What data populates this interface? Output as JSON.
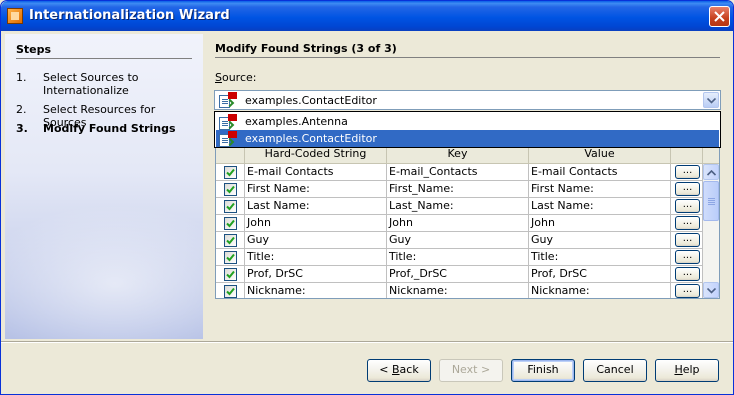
{
  "window": {
    "title": "Internationalization Wizard"
  },
  "steps": {
    "heading": "Steps",
    "items": [
      {
        "num": "1.",
        "label": "Select Sources to Internationalize"
      },
      {
        "num": "2.",
        "label": "Select Resources for Sources"
      },
      {
        "num": "3.",
        "label": "Modify Found Strings"
      }
    ]
  },
  "main": {
    "title": "Modify Found Strings (3 of 3)",
    "source_label": "Source:",
    "source_value": "examples.ContactEditor",
    "dropdown_options": [
      "examples.Antenna",
      "examples.ContactEditor"
    ]
  },
  "table": {
    "columns": [
      "",
      "Hard-Coded String",
      "Key",
      "Value",
      ""
    ],
    "button_label": "...",
    "rows": [
      {
        "checked": true,
        "string": "E-mail Contacts",
        "key": "E-mail_Contacts",
        "value": "E-mail Contacts"
      },
      {
        "checked": true,
        "string": "First Name:",
        "key": "First_Name:",
        "value": "First Name:"
      },
      {
        "checked": true,
        "string": "Last Name:",
        "key": "Last_Name:",
        "value": "Last Name:"
      },
      {
        "checked": true,
        "string": "John",
        "key": "John",
        "value": "John"
      },
      {
        "checked": true,
        "string": "Guy",
        "key": "Guy",
        "value": "Guy"
      },
      {
        "checked": true,
        "string": "Title:",
        "key": "Title:",
        "value": "Title:"
      },
      {
        "checked": true,
        "string": "Prof, DrSC",
        "key": "Prof,_DrSC",
        "value": "Prof, DrSC"
      },
      {
        "checked": true,
        "string": "Nickname:",
        "key": "Nickname:",
        "value": "Nickname:"
      }
    ]
  },
  "buttons": {
    "back": "< Back",
    "next": "Next >",
    "finish": "Finish",
    "cancel": "Cancel",
    "help": "Help"
  }
}
